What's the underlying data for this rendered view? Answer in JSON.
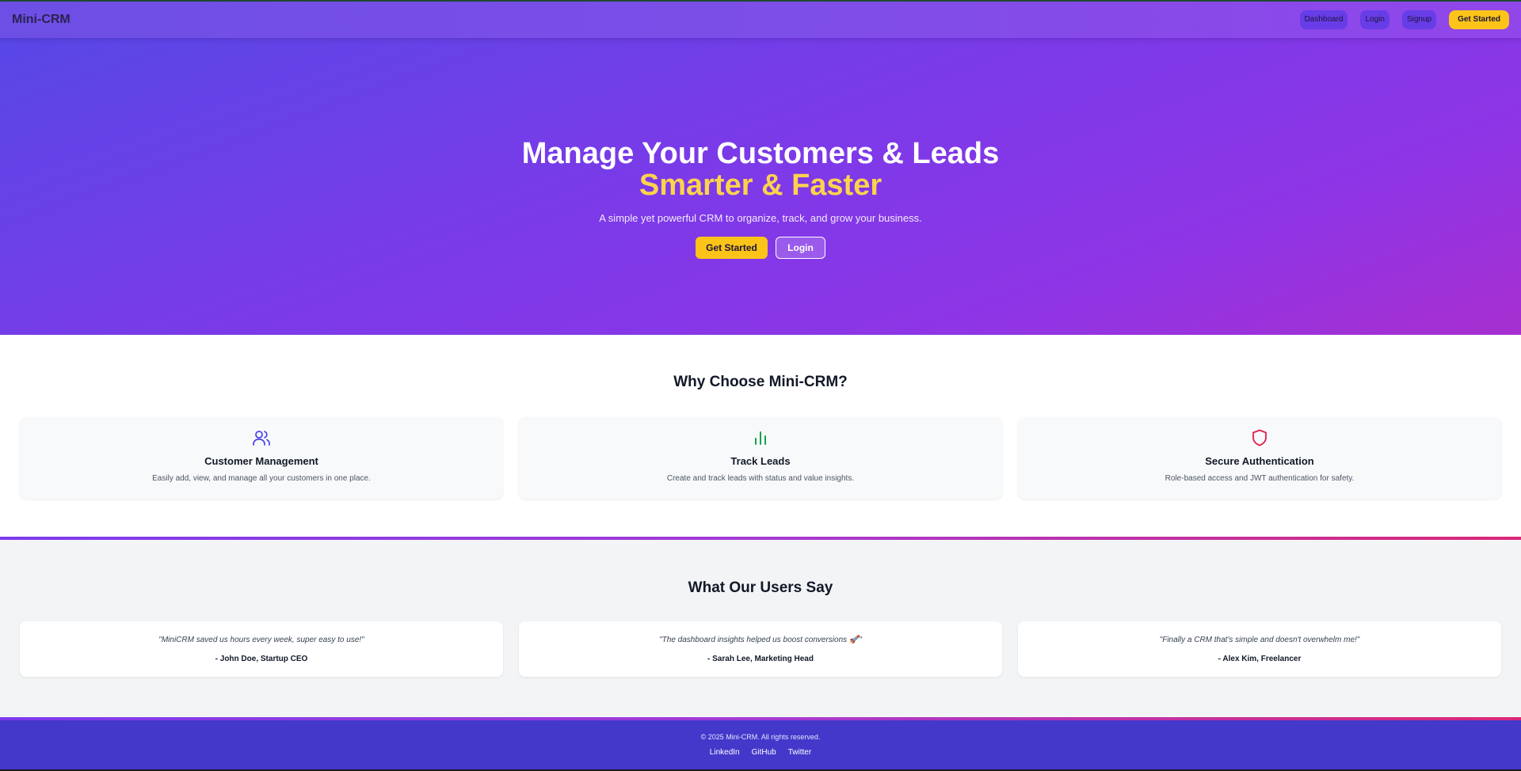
{
  "navbar": {
    "brand": "Mini-CRM",
    "links": [
      "Dashboard",
      "Login",
      "Signup"
    ],
    "cta": "Get Started"
  },
  "hero": {
    "title": "Manage Your Customers & Leads",
    "title_accent": "Smarter & Faster",
    "subtitle": "A simple yet powerful CRM to organize, track, and grow your business.",
    "primary_button": "Get Started",
    "secondary_button": "Login"
  },
  "features": {
    "title": "Why Choose Mini-CRM?",
    "items": [
      {
        "icon": "users-icon",
        "title": "Customer Management",
        "description": "Easily add, view, and manage all your customers in one place.",
        "color": "#4f46e5"
      },
      {
        "icon": "bar-chart-icon",
        "title": "Track Leads",
        "description": "Create and track leads with status and value insights.",
        "color": "#16a34a"
      },
      {
        "icon": "shield-icon",
        "title": "Secure Authentication",
        "description": "Role-based access and JWT authentication for safety.",
        "color": "#e11d48"
      }
    ]
  },
  "testimonials": {
    "title": "What Our Users Say",
    "items": [
      {
        "quote": "\"MiniCRM saved us hours every week, super easy to use!\"",
        "author": "- John Doe, Startup CEO"
      },
      {
        "quote": "\"The dashboard insights helped us boost conversions 🚀\"",
        "author": "- Sarah Lee, Marketing Head"
      },
      {
        "quote": "\"Finally a CRM that's simple and doesn't overwhelm me!\"",
        "author": "- Alex Kim, Freelancer"
      }
    ]
  },
  "footer": {
    "copyright": "© 2025 Mini-CRM. All rights reserved.",
    "links": [
      "LinkedIn",
      "GitHub",
      "Twitter"
    ]
  },
  "colors": {
    "accent_yellow": "#fcc419",
    "primary_purple": "#7c3aed",
    "footer_indigo": "#4338ca"
  }
}
